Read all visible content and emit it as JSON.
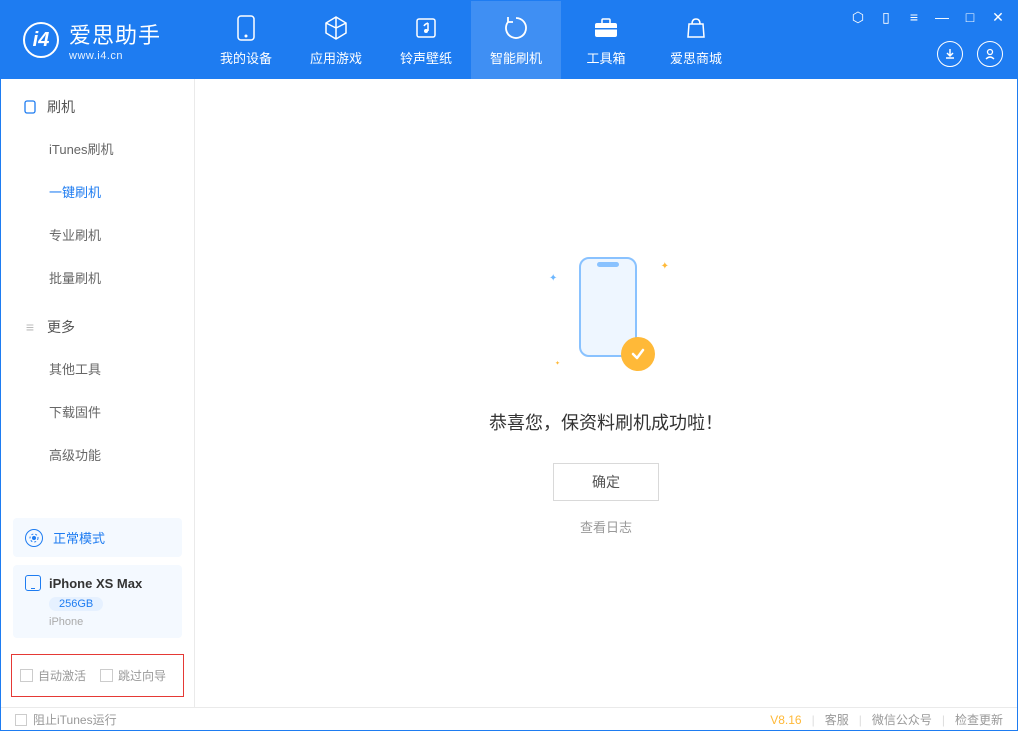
{
  "brand": {
    "title": "爱思助手",
    "subtitle": "www.i4.cn"
  },
  "nav": {
    "tabs": [
      {
        "label": "我的设备"
      },
      {
        "label": "应用游戏"
      },
      {
        "label": "铃声壁纸"
      },
      {
        "label": "智能刷机"
      },
      {
        "label": "工具箱"
      },
      {
        "label": "爱思商城"
      }
    ]
  },
  "sidebar": {
    "group1": {
      "title": "刷机",
      "items": [
        "iTunes刷机",
        "一键刷机",
        "专业刷机",
        "批量刷机"
      ]
    },
    "group2": {
      "title": "更多",
      "items": [
        "其他工具",
        "下载固件",
        "高级功能"
      ]
    },
    "mode": "正常模式",
    "device": {
      "name": "iPhone XS Max",
      "capacity": "256GB",
      "type": "iPhone"
    },
    "checks": {
      "auto_activate": "自动激活",
      "skip_guide": "跳过向导"
    }
  },
  "main": {
    "success_text": "恭喜您，保资料刷机成功啦！",
    "ok_button": "确定",
    "view_log": "查看日志"
  },
  "statusbar": {
    "block_itunes": "阻止iTunes运行",
    "version": "V8.16",
    "support": "客服",
    "wechat": "微信公众号",
    "update": "检查更新"
  }
}
